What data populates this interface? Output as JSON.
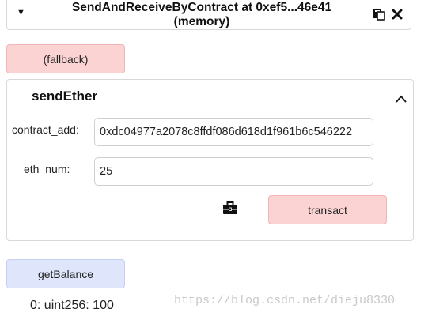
{
  "contract": {
    "title": "SendAndReceiveByContract at 0xef5...46e41\n(memory)",
    "caret_icon": "caret-down-icon",
    "copy_icon": "clipboard-copy-icon",
    "close_icon": "close-icon"
  },
  "fallback": {
    "label": "(fallback)"
  },
  "send_ether": {
    "title": "sendEther",
    "collapse_icon": "chevron-up-icon",
    "params": [
      {
        "label": "contract_add:",
        "value": "0xdc04977a2078c8ffdf086d618d1f961b6c546222"
      },
      {
        "label": "eth_num:",
        "value": "25"
      }
    ],
    "briefcase_icon": "briefcase-icon",
    "transact_label": "transact"
  },
  "get_balance": {
    "label": "getBalance",
    "result": "0: uint256: 100"
  },
  "watermark": "https://blog.csdn.net/dieju8330",
  "colors": {
    "transact_bg": "#fbd3d3",
    "call_bg": "#dfe6fb",
    "border": "#d8d8d8"
  }
}
